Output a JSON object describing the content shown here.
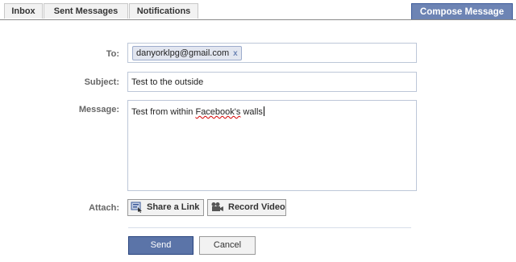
{
  "tabs": {
    "inbox": "Inbox",
    "sent": "Sent Messages",
    "notifications": "Notifications",
    "compose": "Compose Message"
  },
  "form": {
    "to_label": "To:",
    "to_recipient": "danyorklpg@gmail.com",
    "to_remove": "x",
    "subject_label": "Subject:",
    "subject_value": "Test to the outside",
    "message_label": "Message:",
    "message_before": "Test from within ",
    "message_misspelled": "Facebook's",
    "message_after": " walls",
    "attach_label": "Attach:",
    "share_link": "Share a Link",
    "record_video": "Record Video"
  },
  "actions": {
    "send": "Send",
    "cancel": "Cancel"
  }
}
